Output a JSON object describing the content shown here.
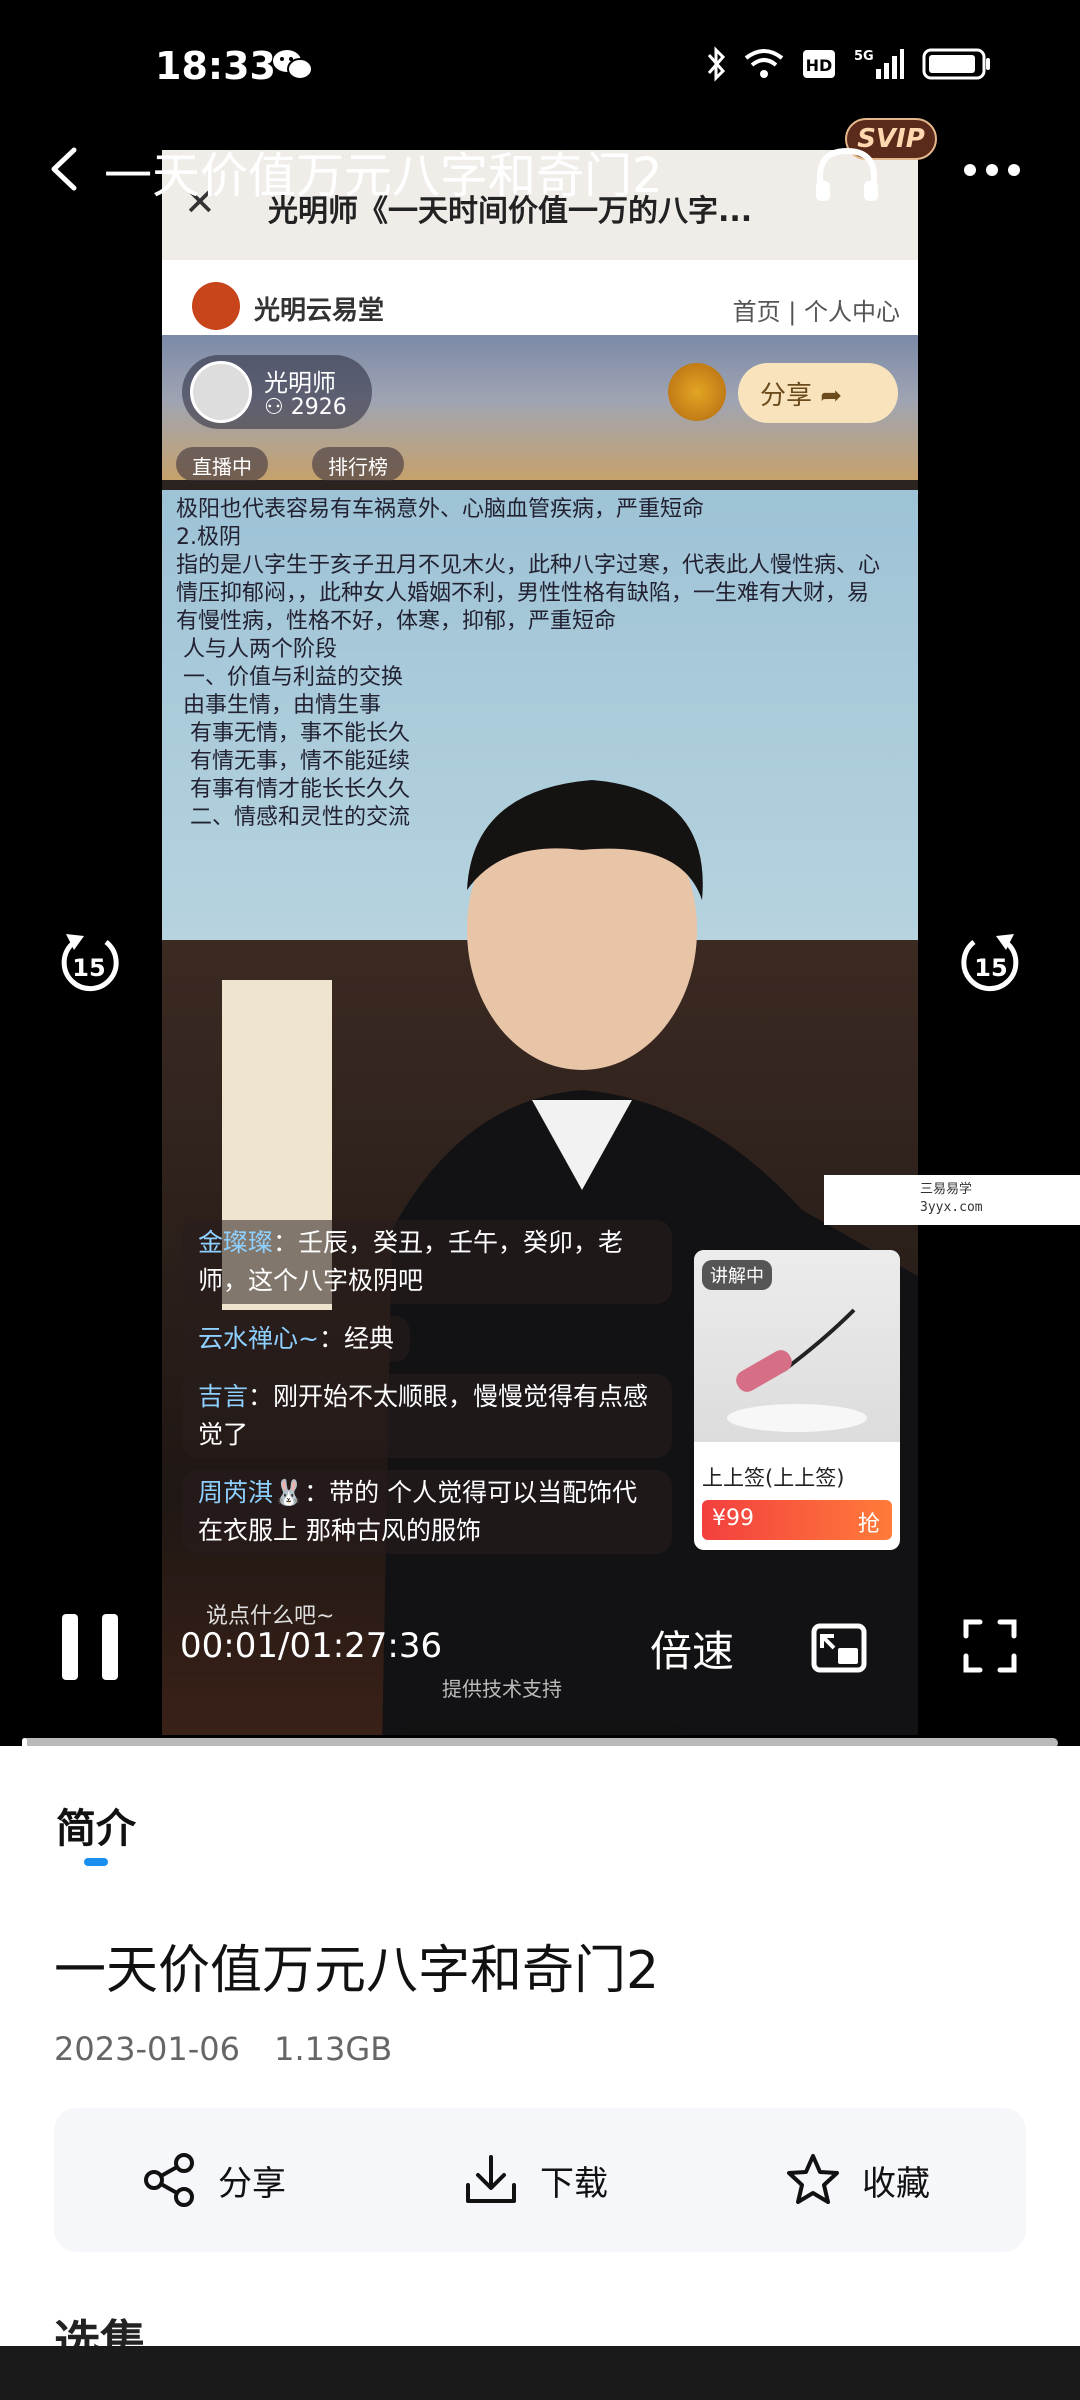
{
  "status_bar": {
    "time": "18:33"
  },
  "header": {
    "title": "一天价值万元八字和奇门2",
    "vip_badge": "SVIP"
  },
  "video_frame": {
    "top_title": "光明师《一天时间价值一万的八字...",
    "brand": "光明云易堂",
    "nav": "首页 | 个人中心",
    "host_name": "光明师",
    "viewers": "2926",
    "share_label": "分享",
    "chip_live": "直播中",
    "chip_rank": "排行榜",
    "board_lines": [
      "极阳也代表容易有车祸意外、心脑血管疾病，严重短命",
      "2.极阴",
      "指的是八字生于亥子丑月不见木火，此种八字过寒，代表此人慢性病、心",
      "情压抑郁闷，，此种女人婚姻不利，男性性格有缺陷，一生难有大财，易",
      "有慢性病，性格不好，体寒，抑郁，严重短命",
      "",
      " 人与人两个阶段",
      " 一、价值与利益的交换",
      " 由事生情，由情生事",
      "  有事无情，事不能长久",
      "  有情无事，情不能延续",
      "  有事有情才能长长久久",
      "  二、情感和灵性的交流"
    ],
    "comments": [
      {
        "user": "金璨璨",
        "text": "：壬辰，癸丑，壬午，癸卯，老师，这个八字极阴吧"
      },
      {
        "user": "云水禅心~",
        "text": "：经典"
      },
      {
        "user": "吉言",
        "text": "：刚开始不太顺眼，慢慢觉得有点感觉了"
      },
      {
        "user": "周芮淇🐰",
        "text": "：带的 个人觉得可以当配饰代在衣服上 那种古风的服饰"
      }
    ],
    "product": {
      "tag": "讲解中",
      "name": "上上签(上上签)",
      "price": "¥99",
      "buy": "抢"
    },
    "say_placeholder": "说点什么吧~",
    "powered": "提供技术支持"
  },
  "watermark": {
    "line1": "三易易学",
    "line2": "3yyx.com"
  },
  "controls": {
    "rewind_seconds": "15",
    "forward_seconds": "15",
    "time": "00:01/01:27:36",
    "speed_label": "倍速",
    "progress_fraction": 0.0002
  },
  "info": {
    "tab": "简介",
    "title": "一天价值万元八字和奇门2",
    "date": "2023-01-06",
    "size": "1.13GB",
    "actions": {
      "share": "分享",
      "download": "下载",
      "favorite": "收藏"
    },
    "next_section_cut": "选集"
  }
}
